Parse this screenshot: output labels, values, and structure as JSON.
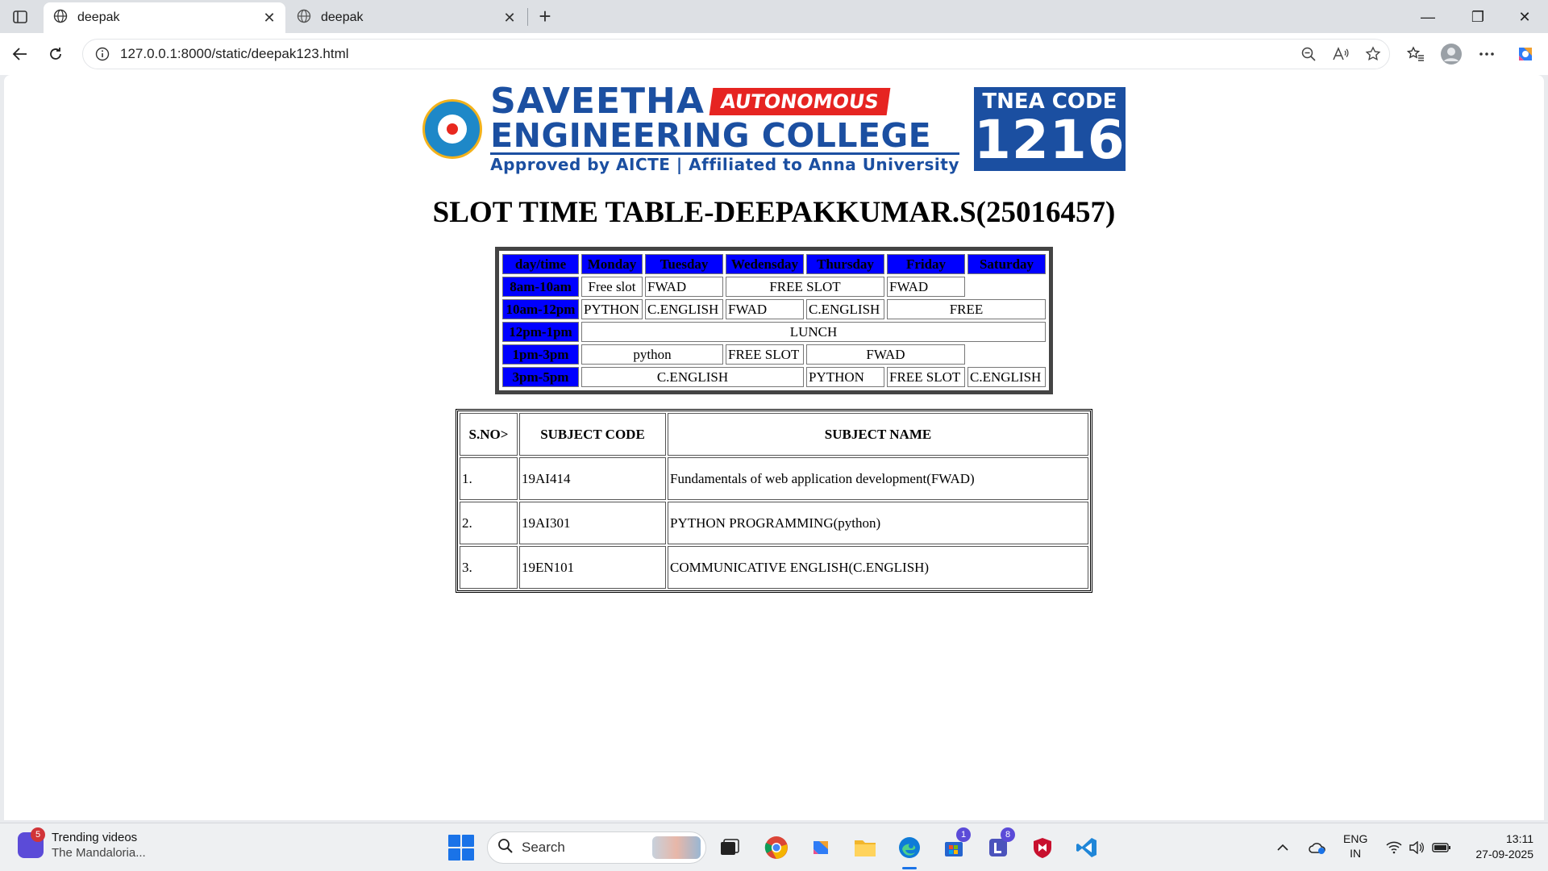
{
  "browser": {
    "tabs": [
      {
        "title": "deepak",
        "active": true,
        "close_glyph": "✕"
      },
      {
        "title": "deepak",
        "active": false,
        "close_glyph": "✕"
      }
    ],
    "new_tab_glyph": "+",
    "url": "127.0.0.1:8000/static/deepak123.html",
    "window_controls": {
      "minimize": "—",
      "restore": "❐",
      "close": "✕"
    }
  },
  "page": {
    "logo": {
      "name_line1": "SAVEETHA",
      "badge": "AUTONOMOUS",
      "name_line2": "ENGINEERING COLLEGE",
      "tagline": "Approved by AICTE  |  Affiliated to Anna University",
      "code_label": "TNEA CODE",
      "code_value": "1216",
      "brand_blue": "#1b4fa1",
      "badge_red": "#e62421"
    },
    "title": "SLOT TIME TABLE-DEEPAKKUMAR.S(25016457)",
    "timetable": {
      "header_color": "#0000ff",
      "headers": [
        "day/time",
        "Monday",
        "Tuesday",
        "Wedensday",
        "Thursday",
        "Friday",
        "Saturday"
      ],
      "rows": [
        {
          "time": "8am-10am",
          "cells": [
            "Free slot",
            "FWAD",
            "FREE SLOT",
            "FWAD",
            ""
          ]
        },
        {
          "time": "10am-12pm",
          "cells": [
            "PYTHON",
            "C.ENGLISH",
            "FWAD",
            "C.ENGLISH",
            "FREE"
          ]
        },
        {
          "time": "12pm-1pm",
          "cells": [
            "LUNCH"
          ]
        },
        {
          "time": "1pm-3pm",
          "cells": [
            "python",
            "FREE SLOT",
            "FWAD",
            ""
          ]
        },
        {
          "time": "3pm-5pm",
          "cells": [
            "C.ENGLISH",
            "PYTHON",
            "FREE SLOT",
            "C.ENGLISH"
          ]
        }
      ]
    },
    "subjects": {
      "headers": [
        "S.NO>",
        "SUBJECT CODE",
        "SUBJECT NAME"
      ],
      "rows": [
        [
          "1.",
          "19AI414",
          "Fundamentals of web application development(FWAD)"
        ],
        [
          "2.",
          "19AI301",
          "PYTHON PROGRAMMING(python)"
        ],
        [
          "3.",
          "19EN101",
          "COMMUNICATIVE ENGLISH(C.ENGLISH)"
        ]
      ]
    }
  },
  "taskbar": {
    "widget": {
      "badge": "5",
      "line1": "Trending videos",
      "line2": "The Mandaloria..."
    },
    "search_label": "Search",
    "app_badges": {
      "store": "1",
      "teams": "8"
    },
    "tray": {
      "lang_line1": "ENG",
      "lang_line2": "IN",
      "time": "13:11",
      "date": "27-09-2025"
    }
  }
}
